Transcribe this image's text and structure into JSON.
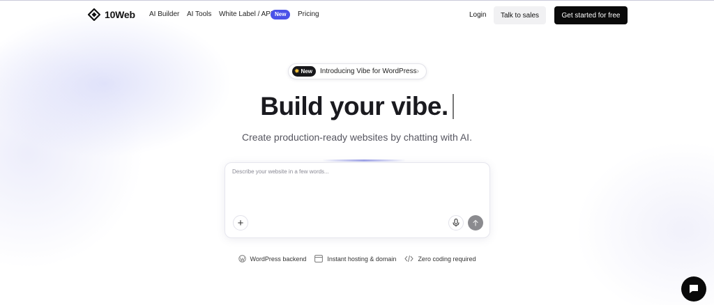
{
  "header": {
    "logo_text": "10Web",
    "nav": [
      {
        "label": "AI Builder"
      },
      {
        "label": "AI Tools"
      },
      {
        "label": "White Label / API",
        "badge": "New"
      },
      {
        "label": "Pricing"
      }
    ],
    "login_label": "Login",
    "sales_label": "Talk to sales",
    "cta_label": "Get started for free"
  },
  "announcement": {
    "badge": "New",
    "text": "Introducing Vibe for WordPress",
    "icon": "chevron-right-icon"
  },
  "hero": {
    "title": "Build your vibe.",
    "subtitle": "Create production-ready websites by chatting with AI."
  },
  "prompt": {
    "placeholder": "Describe your website in a few words...",
    "value": ""
  },
  "features": [
    {
      "icon": "wordpress-icon",
      "label": "WordPress backend"
    },
    {
      "icon": "server-icon",
      "label": "Instant hosting & domain"
    },
    {
      "icon": "code-icon",
      "label": "Zero coding required"
    }
  ],
  "colors": {
    "accent": "#4a52e8",
    "cta_bg": "#0a0a0a",
    "send_button": "#8b8b8f"
  }
}
